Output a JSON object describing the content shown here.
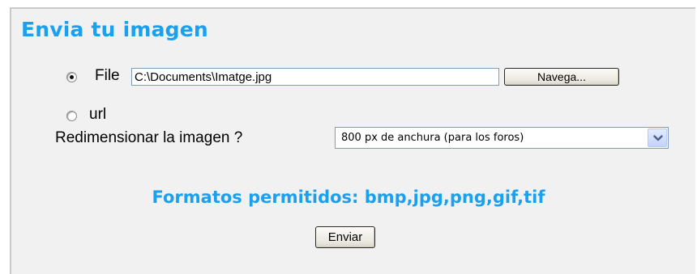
{
  "form": {
    "title": "Envia tu imagen",
    "file_option_label": "File",
    "file_path_value": "C:\\Documents\\Imatge.jpg",
    "browse_button_label": "Navega...",
    "url_option_label": "url",
    "selected_source": "File",
    "resize_label": "Redimensionar la imagen ?",
    "resize_selected_value": "800 px de anchura (para los foros)",
    "formats_text": "Formatos permitidos: bmp,jpg,png,gif,tif",
    "submit_button_label": "Enviar"
  },
  "icons": {
    "dropdown": "chevron-down-icon"
  },
  "colors": {
    "accent": "#1aa0ef",
    "panel_background": "#f1f1f1",
    "select_arrow": "#4d6185"
  }
}
